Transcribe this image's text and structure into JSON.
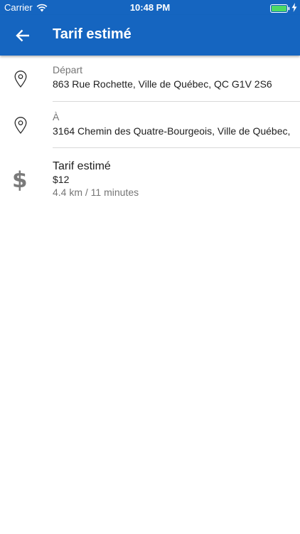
{
  "status_bar": {
    "carrier": "Carrier",
    "time": "10:48 PM",
    "icons": [
      "wifi-icon",
      "battery-icon",
      "charging-icon"
    ],
    "battery_color": "#4cd964"
  },
  "app_bar": {
    "title": "Tarif estimé",
    "back_icon": "arrow-left-icon",
    "color": "#1565c0"
  },
  "trip": {
    "departure": {
      "icon": "location-pin-icon",
      "label": "Départ",
      "address": "863 Rue Rochette, Ville de Québec, QC G1V 2S6"
    },
    "destination": {
      "icon": "location-pin-icon",
      "label": "À",
      "address": "3164 Chemin des Quatre-Bourgeois, Ville de Québec,"
    }
  },
  "fare": {
    "icon": "dollar-icon",
    "title": "Tarif estimé",
    "amount": "$12",
    "details": "4.4 km / 11 minutes"
  }
}
